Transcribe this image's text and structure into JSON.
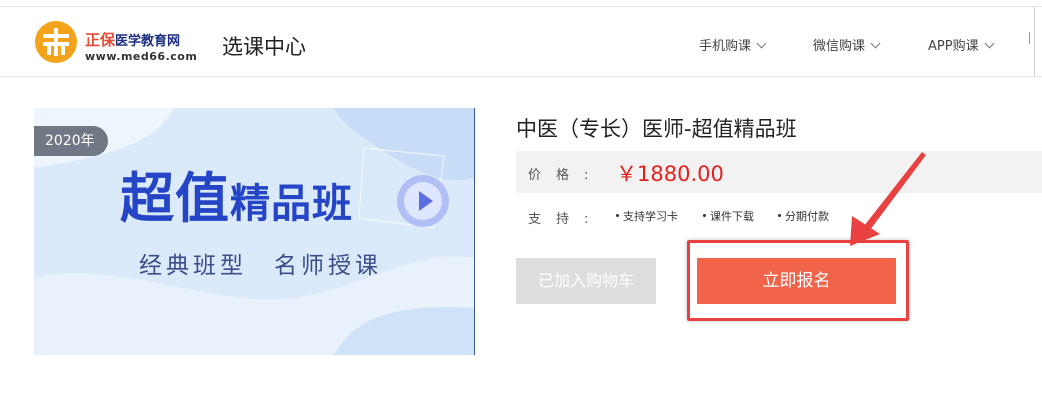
{
  "header": {
    "logo": {
      "brand_main": "正保",
      "brand_rest": "医学教育网",
      "url": "www.med66.com",
      "colors": {
        "orange": "#f3a21b",
        "red": "#e44c35",
        "navy": "#1d2f80"
      }
    },
    "page_title": "选课中心",
    "nav": [
      {
        "label": "手机购课"
      },
      {
        "label": "微信购课"
      },
      {
        "label": "APP购课"
      }
    ]
  },
  "banner": {
    "year": "2020年",
    "title_big": "超值",
    "title_small": "精品班",
    "subtitle": "经典班型　名师授课",
    "icon": "play-icon"
  },
  "product": {
    "title": "中医（专长）医师-超值精品班",
    "price_label": "价格:",
    "price": "￥1880.00",
    "support_label": "支持:",
    "support_items": [
      "支持学习卡",
      "课件下载",
      "分期付款"
    ],
    "colors": {
      "price": "#e5211d",
      "price_bg": "#f2f2f2"
    }
  },
  "buttons": {
    "cart_label": "已加入购物车",
    "enroll_label": "立即报名",
    "colors": {
      "enroll": "#f2644a",
      "cart_disabled": "#dddddd",
      "highlight": "#e8413f"
    }
  }
}
